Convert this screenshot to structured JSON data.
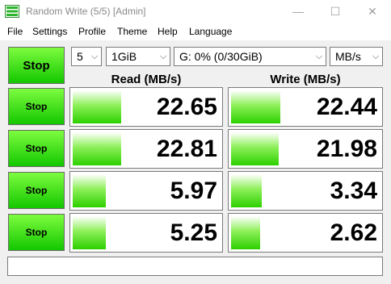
{
  "window": {
    "title": "Random Write (5/5) [Admin]",
    "minimize_glyph": "—",
    "maximize_glyph": "☐",
    "close_glyph": "✕"
  },
  "menu": [
    "File",
    "Settings",
    "Profile",
    "Theme",
    "Help",
    "Language"
  ],
  "toolbar": {
    "stop_all_label": "Stop",
    "count": "5",
    "size": "1GiB",
    "drive": "G: 0% (0/30GiB)",
    "unit": "MB/s"
  },
  "headers": {
    "read": "Read (MB/s)",
    "write": "Write (MB/s)"
  },
  "rows": [
    {
      "stop_label": "Stop",
      "read": "22.65",
      "write": "22.44",
      "read_level": 0.32,
      "write_level": 0.32
    },
    {
      "stop_label": "Stop",
      "read": "22.81",
      "write": "21.98",
      "read_level": 0.32,
      "write_level": 0.31
    },
    {
      "stop_label": "Stop",
      "read": "5.97",
      "write": "3.34",
      "read_level": 0.22,
      "write_level": 0.2
    },
    {
      "stop_label": "Stop",
      "read": "5.25",
      "write": "2.62",
      "read_level": 0.22,
      "write_level": 0.19
    }
  ],
  "status_text": "",
  "colors": {
    "bar_green": "#2dd000",
    "button_green": "#13c700"
  }
}
